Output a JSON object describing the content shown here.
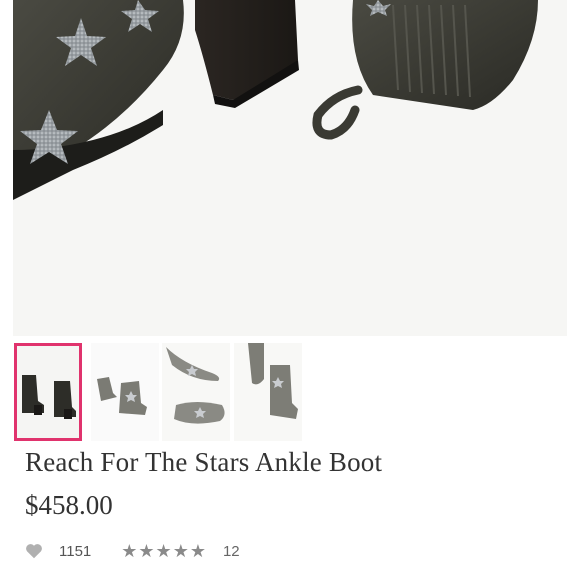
{
  "product": {
    "title": "Reach For The Stars Ankle Boot",
    "price": "$458.00"
  },
  "gallery": {
    "hero_icon": "boot-photo",
    "thumbnails": [
      {
        "name": "thumbnail-1",
        "selected": true
      },
      {
        "name": "thumbnail-2",
        "selected": false
      },
      {
        "name": "thumbnail-3",
        "selected": false
      },
      {
        "name": "thumbnail-4",
        "selected": false
      }
    ],
    "selected_color": "#e0336d"
  },
  "social": {
    "like_icon": "heart-icon",
    "like_count": "1151",
    "rating": {
      "value": 5,
      "max": 5,
      "icon": "star-icon"
    },
    "review_count": "12"
  }
}
